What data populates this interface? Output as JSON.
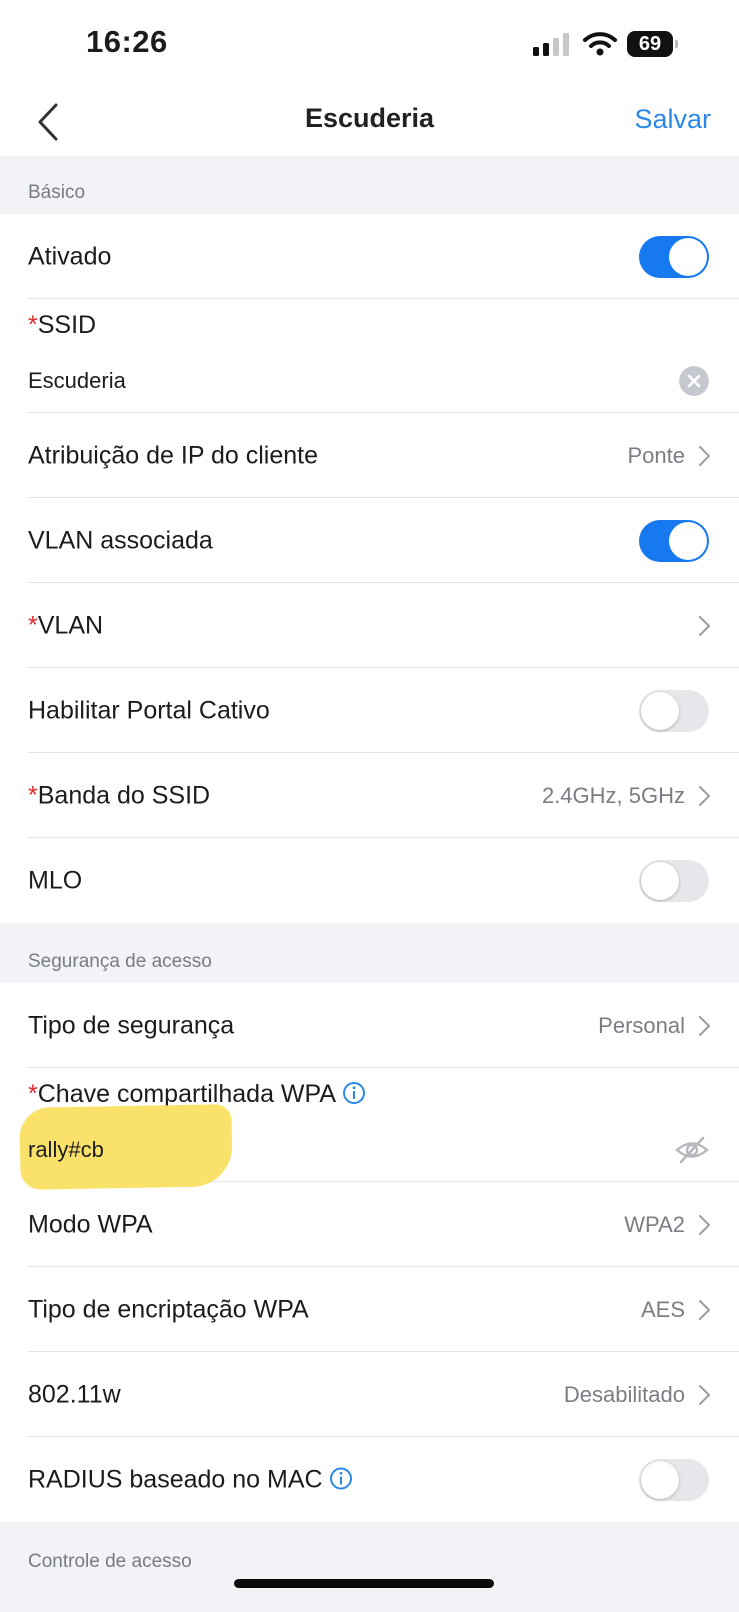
{
  "status": {
    "time": "16:26",
    "battery": "69"
  },
  "nav": {
    "title": "Escuderia",
    "save": "Salvar"
  },
  "sections": {
    "basic": "Básico",
    "security": "Segurança de acesso",
    "access": "Controle de acesso"
  },
  "rows": {
    "enabled": {
      "label": "Ativado",
      "on": true
    },
    "ssid": {
      "required": "*",
      "label": "SSID",
      "value": "Escuderia"
    },
    "ip_assign": {
      "label": "Atribuição de IP do cliente",
      "value": "Ponte"
    },
    "vlan_assoc": {
      "label": "VLAN associada",
      "on": true
    },
    "vlan": {
      "required": "*",
      "label": "VLAN"
    },
    "captive": {
      "label": "Habilitar Portal Cativo",
      "on": false
    },
    "band": {
      "required": "*",
      "label": "Banda do SSID",
      "value": "2.4GHz, 5GHz"
    },
    "mlo": {
      "label": "MLO",
      "on": false
    },
    "sec_type": {
      "label": "Tipo de segurança",
      "value": "Personal"
    },
    "wpa_key": {
      "required": "*",
      "label": "Chave compartilhada WPA",
      "value": "rally#cb"
    },
    "wpa_mode": {
      "label": "Modo WPA",
      "value": "WPA2"
    },
    "wpa_enc": {
      "label": "Tipo de encriptação WPA",
      "value": "AES"
    },
    "w80211": {
      "label": "802.11w",
      "value": "Desabilitado"
    },
    "radius_mac": {
      "label": "RADIUS baseado no MAC",
      "on": false
    }
  },
  "colors": {
    "accent": "#1679f0",
    "link": "#2a88e6",
    "required": "#e02b2b",
    "highlight": "#f9df5a"
  }
}
